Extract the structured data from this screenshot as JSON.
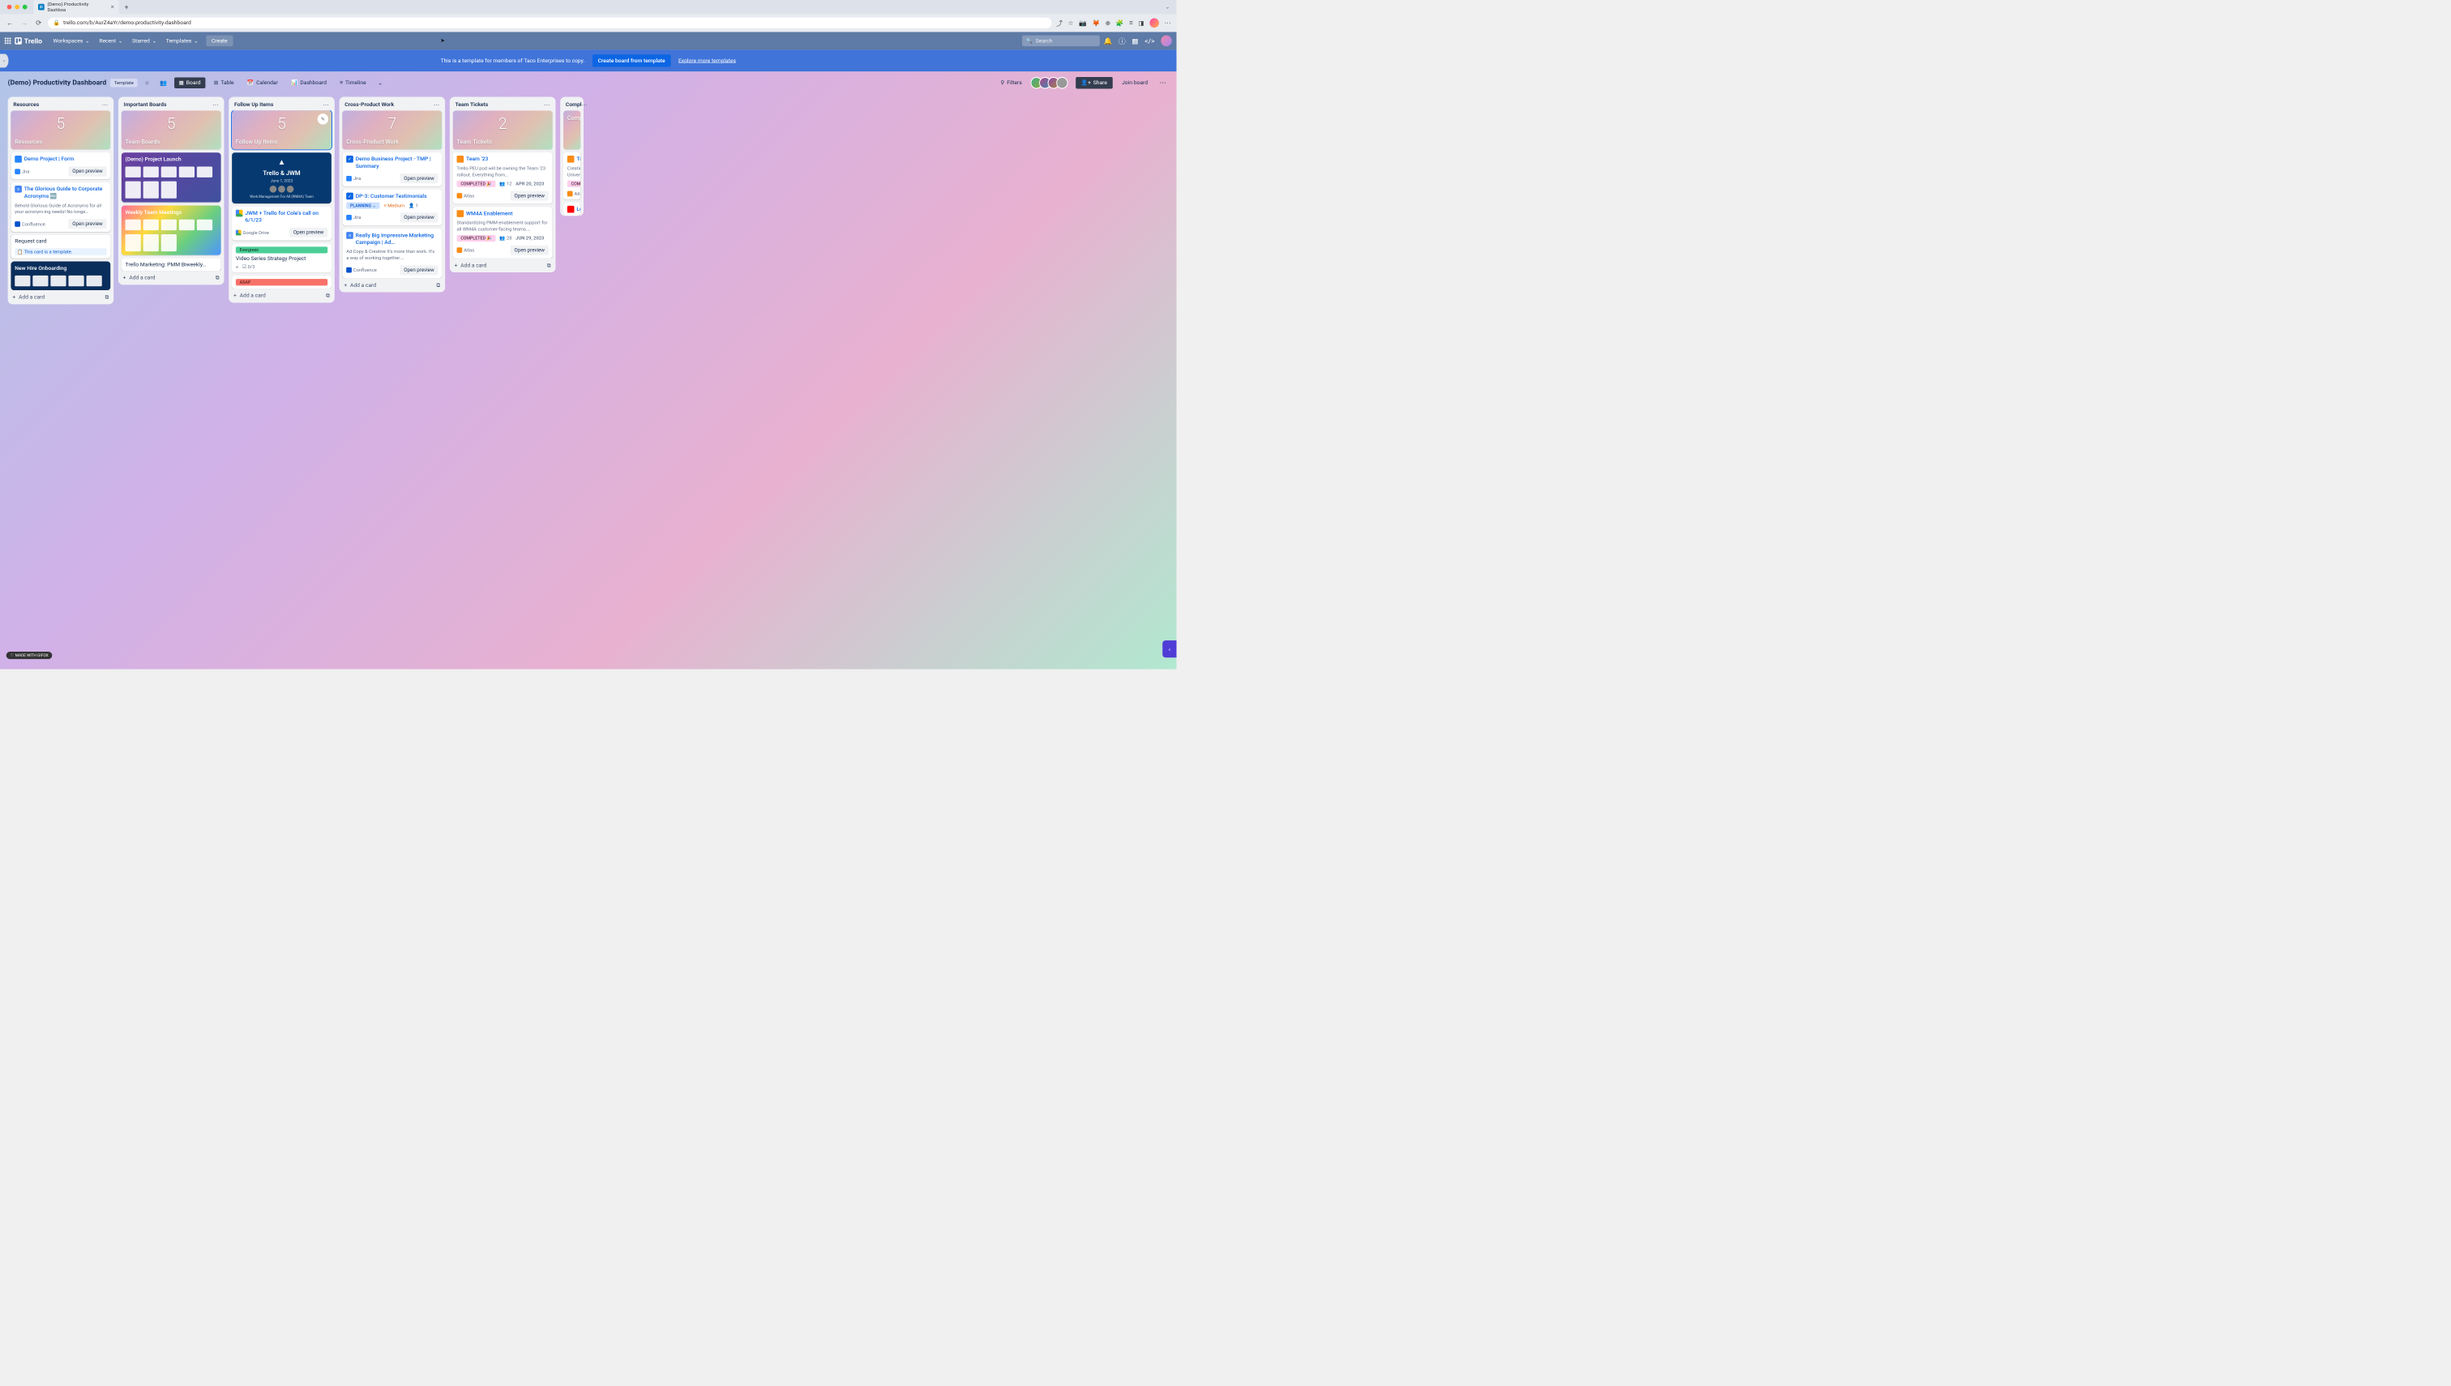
{
  "browser": {
    "tab_title": "(Demo) Productivity Dashboa",
    "url": "trello.com/b/AurZ4aYr/demo-productivity-dashboard"
  },
  "header": {
    "logo": "Trello",
    "nav": {
      "workspaces": "Workspaces",
      "recent": "Recent",
      "starred": "Starred",
      "templates": "Templates"
    },
    "create": "Create",
    "search_placeholder": "Search"
  },
  "banner": {
    "text": "This is a template for members of Taco Enterprises to copy.",
    "create_btn": "Create board from template",
    "explore_link": "Explore more templates"
  },
  "board": {
    "title": "(Demo) Productivity Dashboard",
    "template_badge": "Template",
    "views": {
      "board": "Board",
      "table": "Table",
      "calendar": "Calendar",
      "dashboard": "Dashboard",
      "timeline": "Timeline"
    },
    "filters": "Filters",
    "share": "Share",
    "join": "Join board"
  },
  "lists": [
    {
      "name": "Resources",
      "cover": {
        "number": "5",
        "label": "Resources"
      },
      "cards": [
        {
          "link_title": "Demo Project | Form",
          "source": "Jira",
          "source_icon": "jira",
          "preview": "Open preview",
          "icon": "jira"
        },
        {
          "link_title": "The Glorious Guide to Corporate Acronyms 🔤",
          "desc": "Behold Glorious Guide of Acronyms for all your acronym-ing needs! No longe…",
          "source": "Confluence",
          "source_icon": "conf",
          "preview": "Open preview",
          "icon": "gdoc"
        },
        {
          "title": "Request card",
          "template_tag": "This card is a template."
        },
        {
          "board_thumb": true,
          "thumb_class": "thumb-navy",
          "thumb_title": "New Hire Onboarding"
        }
      ]
    },
    {
      "name": "Important Boards",
      "cover": {
        "number": "5",
        "label": "Team Boards"
      },
      "cards": [
        {
          "board_thumb": true,
          "thumb_class": "thumb-purple",
          "thumb_title": "(Demo) Project Launch"
        },
        {
          "board_thumb": true,
          "thumb_class": "thumb-rainbow",
          "thumb_title": "Weekly Team Meetings"
        },
        {
          "title": "Trello Marketing: PMM Biweekly…"
        }
      ]
    },
    {
      "name": "Follow Up Items",
      "cover": {
        "number": "5",
        "label": "Follow Up Items",
        "selected": true,
        "edit": true
      },
      "cards": [
        {
          "jwm": true,
          "jwm_title": "Trello & JWM",
          "jwm_date": "June 1, 2023",
          "jwm_sub": "Work Management For All (WM4A) Team"
        },
        {
          "link_title": "JWM + Trello for Cole's call on 6/1/23",
          "source": "Google Drive",
          "source_icon": "drive",
          "preview": "Open preview",
          "icon": "drive"
        },
        {
          "label": "Evergreen",
          "label_class": "lbl-green",
          "title": "Video Series Strategy Project",
          "badges": [
            {
              "icon": "≡"
            },
            {
              "icon": "☑",
              "text": "0/3"
            }
          ]
        },
        {
          "label": "ASAP",
          "label_class": "lbl-red"
        }
      ]
    },
    {
      "name": "Cross-Product Work",
      "cover": {
        "number": "7",
        "label": "Cross-Product Work"
      },
      "cards": [
        {
          "link_title": "Demo Business Project - TMP | Summary",
          "source": "Jira",
          "source_icon": "jira",
          "preview": "Open preview",
          "icon": "check"
        },
        {
          "link_title": "DP-3: Customer Testimonials",
          "badges_row": [
            {
              "label": "PLANNING ⌄",
              "label_class": "lbl-planning"
            },
            {
              "medium": "Medium"
            },
            {
              "icon": "👤",
              "text": "1"
            }
          ],
          "source": "Jira",
          "source_icon": "jira",
          "preview": "Open preview",
          "icon": "check"
        },
        {
          "link_title": "Really Big Impressive Marketing Campaign | Ad…",
          "desc": "Ad Copy & Creative It's more than work. It's a way of working together.…",
          "source": "Confluence",
          "source_icon": "conf",
          "preview": "Open preview",
          "icon": "gdoc"
        }
      ]
    },
    {
      "name": "Team Tickets",
      "cover": {
        "number": "2",
        "label": "Team Tickets"
      },
      "cards": [
        {
          "link_title": "Team '23",
          "desc": "Trello PEU pod will be owning the Team '23 rollout. Everything from…",
          "badges_row": [
            {
              "label": "COMPLETED 🎉",
              "label_class": "lbl-completed"
            },
            {
              "icon": "👥",
              "text": "12"
            },
            {
              "date": "APR 20, 2023"
            }
          ],
          "source": "Atlas",
          "source_icon": "atlas",
          "preview": "Open preview",
          "icon": "atlas"
        },
        {
          "link_title": "WM4A Enablement",
          "desc": "Standardizing PMM enablement support for all WM4A customer-facing teams.…",
          "badges_row": [
            {
              "label": "COMPLETED 🎉",
              "label_class": "lbl-completed"
            },
            {
              "icon": "👥",
              "text": "28"
            },
            {
              "date": "JUN 29, 2023"
            }
          ],
          "source": "Atlas",
          "source_icon": "atlas",
          "preview": "Open preview",
          "icon": "atlas"
        }
      ]
    },
    {
      "name": "Compl",
      "partial": true,
      "cover": {
        "label": "Compl"
      },
      "cards": [
        {
          "link_title": "Tre",
          "sub": "Un",
          "desc": "Creatin Univers",
          "badges_row": [
            {
              "label": "COMPL",
              "label_class": "lbl-completed"
            }
          ],
          "source": "Atlas",
          "source_icon": "atlas",
          "icon": "atlas"
        },
        {
          "link_title": "Lea",
          "sub": "Tre",
          "icon": "yt"
        }
      ]
    }
  ],
  "add_card": "Add a card",
  "gifox": "MADE WITH GIFOX"
}
